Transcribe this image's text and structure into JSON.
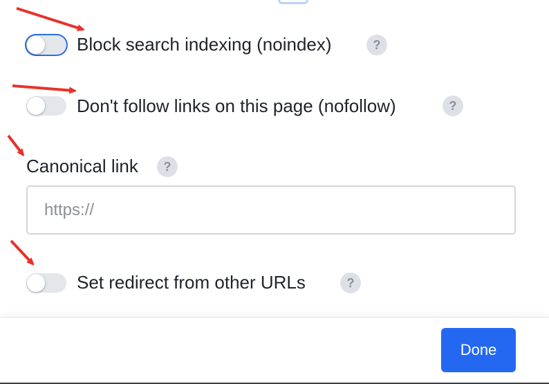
{
  "settings": {
    "noindex": {
      "label": "Block search indexing (noindex)",
      "enabled": false,
      "help": "?"
    },
    "nofollow": {
      "label": "Don't follow links on this page (nofollow)",
      "enabled": false,
      "help": "?"
    },
    "canonical": {
      "label": "Canonical link",
      "help": "?",
      "placeholder": "https://",
      "value": ""
    },
    "redirect": {
      "label": "Set redirect from other URLs",
      "enabled": false,
      "help": "?"
    }
  },
  "footer": {
    "done_label": "Done"
  },
  "annotations": {
    "arrow_color": "#e8322a"
  },
  "colors": {
    "primary": "#2468f2",
    "toggle_off": "#e3e6ea",
    "help_bg": "#dde1e7"
  }
}
